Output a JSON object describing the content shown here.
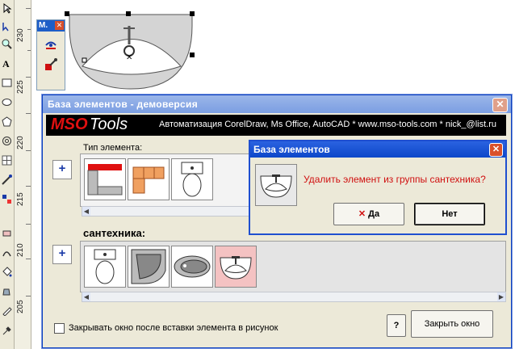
{
  "ruler": {
    "labels": [
      "230",
      "225",
      "220",
      "215",
      "210",
      "205"
    ]
  },
  "mini_panel": {
    "title": "M.",
    "close": "✕"
  },
  "main_window": {
    "title": "База элементов - демоверсия",
    "close": "✕",
    "banner": {
      "brand_mso": "MSO",
      "brand_tools": "Tools",
      "info": "Автоматизация CorelDraw, Ms Office, AutoCAD * www.mso-tools.com * nick_@list.ru"
    },
    "type_label": "Тип элемента:",
    "group_label": "сантехника:",
    "add_button": "+",
    "checkbox_label": "Закрывать окно после вставки элемента в рисунок",
    "help_button": "?",
    "close_button": "Закрыть окно"
  },
  "dialog": {
    "title": "База элементов",
    "close": "✕",
    "message": "Удалить элемент из группы сантехника?",
    "yes_icon": "✕",
    "yes": "Да",
    "no": "Нет"
  },
  "icons": [
    "pick-tool-icon",
    "shape-tool-icon",
    "zoom-tool-icon",
    "text-tool-icon",
    "rectangle-tool-icon",
    "ellipse-tool-icon",
    "polygon-tool-icon",
    "spiral-tool-icon",
    "fill-tool-icon",
    "eyedropper-tool-icon"
  ],
  "colors": {
    "title_blue": "#0a3fbf",
    "dialog_message": "#d01010",
    "brand_red": "#e01010",
    "selected_thumb": "#f4c2c2"
  }
}
